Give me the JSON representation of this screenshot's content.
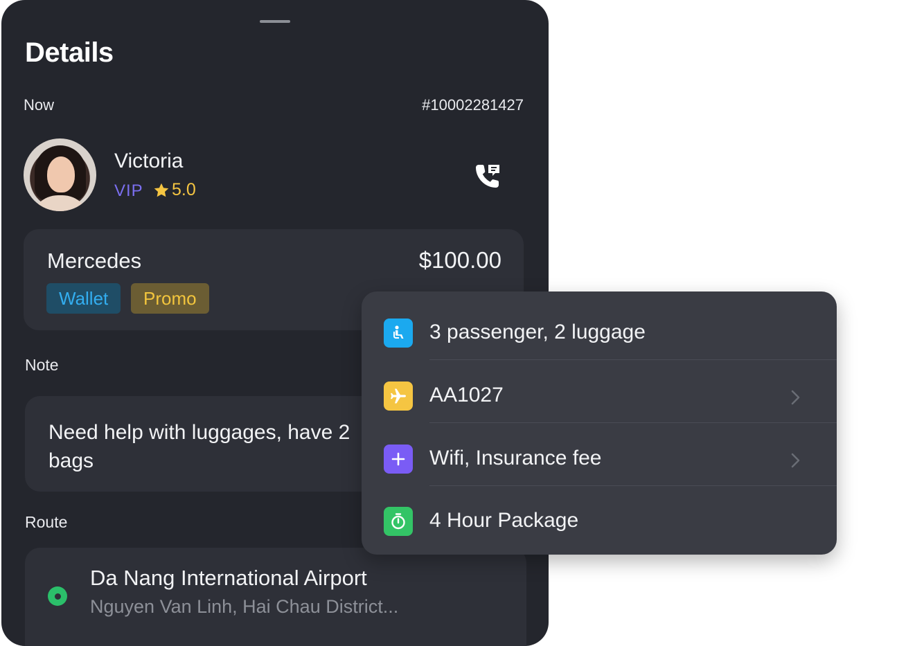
{
  "sheet": {
    "title": "Details",
    "timing": "Now",
    "order_id": "#10002281427"
  },
  "rider": {
    "name": "Victoria",
    "tier": "VIP",
    "rating": "5.0",
    "avatar_icon": "user-avatar-photo",
    "call_icon": "phone-call-icon"
  },
  "vehicle": {
    "name": "Mercedes",
    "price": "$100.00",
    "tags": [
      "Wallet",
      "Promo"
    ]
  },
  "note": {
    "label": "Note",
    "text_line1": "Need help with luggages, have 2",
    "text_line2": "bags"
  },
  "route": {
    "label": "Route",
    "pickup_title": "Da Nang International Airport",
    "pickup_address": "Nguyen Van Linh, Hai Chau District..."
  },
  "extras": [
    {
      "icon": "passenger-seat-icon",
      "label": "3 passenger, 2 luggage",
      "color": "#1ba9ef",
      "has_chevron": false
    },
    {
      "icon": "airplane-icon",
      "label": "AA1027",
      "color": "#f5c542",
      "has_chevron": true
    },
    {
      "icon": "plus-icon",
      "label": "Wifi, Insurance fee",
      "color": "#7a5cf5",
      "has_chevron": true
    },
    {
      "icon": "stopwatch-icon",
      "label": "4 Hour Package",
      "color": "#33c466",
      "has_chevron": false
    }
  ],
  "colors": {
    "panel_bg": "#24262d",
    "card_bg": "#2e3038",
    "popup_bg": "#3a3c44",
    "vip": "#7b6ff0",
    "star": "#f5c542",
    "wallet": "#33aef0",
    "promo": "#f2c53d",
    "route_dot": "#2bbf6a"
  }
}
